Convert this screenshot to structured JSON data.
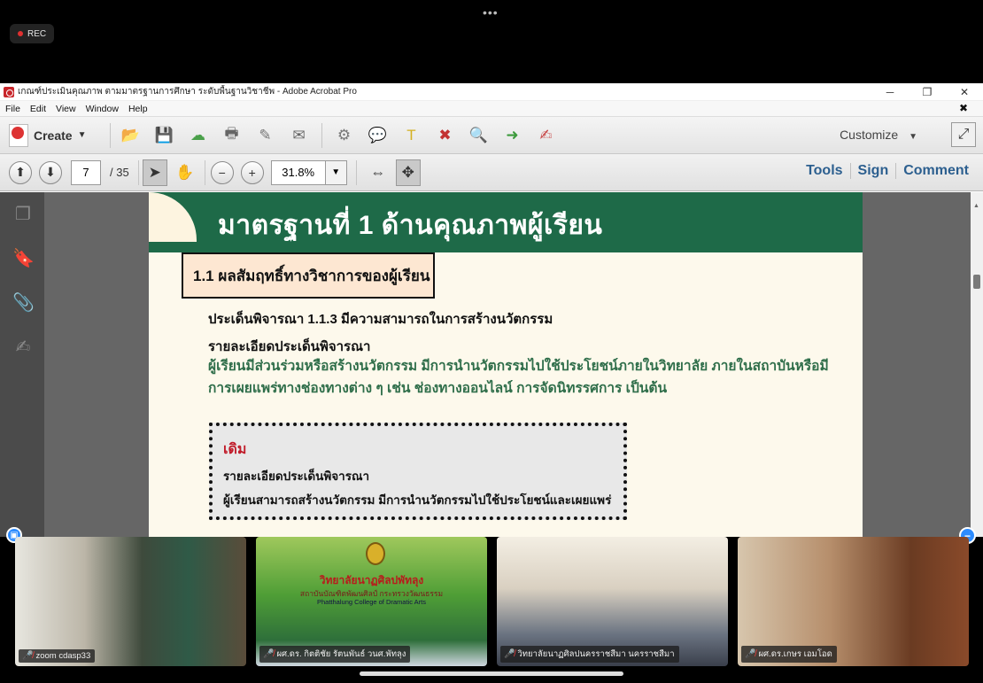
{
  "zoom": {
    "dots": "•••",
    "rec_label": "REC",
    "colors": {
      "rec_dot": "#e03030",
      "accent": "#2d8cff"
    }
  },
  "window": {
    "title": "เกณฑ์ประเมินคุณภาพ ตามมาตรฐานการศึกษา ระดับพื้นฐานวิชาชีพ - Adobe Acrobat Pro",
    "controls": {
      "minimize": "─",
      "maximize": "❐",
      "close": "✕"
    }
  },
  "menu": {
    "items": [
      "File",
      "Edit",
      "View",
      "Window",
      "Help"
    ],
    "close_doc": "✖"
  },
  "toolbar": {
    "create_label": "Create",
    "customize_label": "Customize",
    "icons": [
      {
        "name": "open-folder-icon",
        "glyph": "📂",
        "color": "#f0b73a"
      },
      {
        "name": "save-icon",
        "glyph": "💾",
        "color": "#4a78b5"
      },
      {
        "name": "cloud-upload-icon",
        "glyph": "☁",
        "color": "#4aa04a"
      },
      {
        "name": "print-icon",
        "glyph": "🖶",
        "color": "#666666"
      },
      {
        "name": "edit-document-icon",
        "glyph": "✎",
        "color": "#777777"
      },
      {
        "name": "email-icon",
        "glyph": "✉",
        "color": "#666666"
      },
      {
        "name": "settings-gear-icon",
        "glyph": "⚙",
        "color": "#777777"
      },
      {
        "name": "comment-bubble-icon",
        "glyph": "💬",
        "color": "#e8c020"
      },
      {
        "name": "highlight-text-icon",
        "glyph": "T",
        "color": "#d4b020"
      },
      {
        "name": "delete-page-icon",
        "glyph": "✖",
        "color": "#c33333"
      },
      {
        "name": "find-icon",
        "glyph": "🔍",
        "color": "#4a78b5"
      },
      {
        "name": "export-icon",
        "glyph": "➜",
        "color": "#3c9a3c"
      },
      {
        "name": "sign-pen-icon",
        "glyph": "✍",
        "color": "#c84a4a"
      }
    ]
  },
  "nav": {
    "current_page": "7",
    "total_pages": "/ 35",
    "zoom_level": "31.8%",
    "links": [
      "Tools",
      "Sign",
      "Comment"
    ]
  },
  "document": {
    "banner_title": "มาตรฐานที่ 1 ด้านคุณภาพผู้เรียน",
    "section_title": "1.1 ผลสัมฤทธิ์ทางวิชาการของผู้เรียน",
    "issue": "ประเด็นพิจารณา 1.1.3 มีความสามารถในการสร้างนวัตกรรม",
    "detail_heading": "รายละเอียดประเด็นพิจารณา",
    "description": "ผู้เรียนมีส่วนร่วมหรือสร้างนวัตกรรม มีการนำนวัตกรรมไปใช้ประโยชน์ภายในวิทยาลัย ภายในสถาบันหรือมีการเผยแพร่ทางช่องทางต่าง ๆ เช่น ช่องทางออนไลน์ การจัดนิทรรศการ เป็นต้น",
    "old_box": {
      "label": "เดิม",
      "detail_heading": "รายละเอียดประเด็นพิจารณา",
      "text": "ผู้เรียนสามารถสร้างนวัตกรรม มีการนำนวัตกรรมไปใช้ประโยชน์และเผยแพร่"
    },
    "colors": {
      "banner": "#1e6a48",
      "description": "#2f6e4a",
      "old_label": "#c11c2a",
      "section_bg": "#fde7d2"
    }
  },
  "participants": [
    {
      "name": "zoom cdasp33",
      "muted": true
    },
    {
      "name": "ผศ.ดร. กิตติชัย รัตนพันธ์ วนศ.พัทลุง",
      "muted": true,
      "screen_text": {
        "college": "วิทยาลัยนาฏศิลปพัทลุง",
        "institute": "สถาบันบัณฑิตพัฒนศิลป์ กระทรวงวัฒนธรรม",
        "english": "Phatthalung College of Dramatic Arts"
      }
    },
    {
      "name": "วิทยาลัยนาฏศิลปนครราชสีมา นครราชสีมา",
      "muted": true
    },
    {
      "name": "ผศ.ดร.เกษร  เอมโอด",
      "muted": true
    }
  ]
}
